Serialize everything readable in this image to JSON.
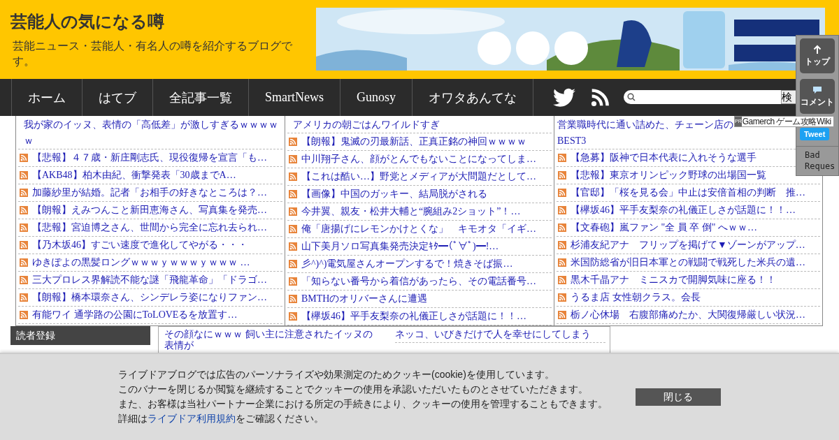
{
  "site": {
    "title": "芸能人の気になる噂",
    "tagline": "芸能ニュース・芸能人・有名人の噂を紹介するブログです。"
  },
  "nav": {
    "items": [
      "ホーム",
      "はてブ",
      "全記事一覧",
      "SmartNews",
      "Gunosy",
      "オワタあんてな"
    ],
    "search_button": "検"
  },
  "side_panel": {
    "buttons": [
      {
        "kind": "top",
        "label": "トップ"
      },
      {
        "kind": "comment",
        "label": "コメント"
      }
    ],
    "tweet": "Tweet",
    "error_text": "Bad Reques"
  },
  "tooltip": {
    "badge": "PR",
    "text": "Gamerch ゲーム攻略Wiki"
  },
  "columns": [
    {
      "heading": [
        "我が家のイッヌ、表情の「高低差」が激しすぎるｗｗｗｗ",
        "ｗ"
      ],
      "items": [
        "【悲報】４７歳・新庄剛志氏、現役復帰を宣言「も…",
        "【AKB48】柏木由紀、衝撃発表「30歳までA…",
        "加藤紗里が結婚。記者「お相手の好きなところは？…",
        "【朗報】えみつんこと新田恵海さん、写真集を発売…",
        "【悲報】宮迫博之さん、世間から完全に忘れ去られ…",
        "【乃木坂46】すごい速度で進化してやがる・・・",
        "ゆきぽよの黒髪ロングｗｗｗｙｗｗｗｙｗｗｗ …",
        "三大プロレス界解読不能な謎「飛龍革命」「ドラゴ…",
        "【朗報】橋本環奈さん、シンデレラ姿になりファン…",
        "有能ワイ 通学路の公園にToLOVEるを放置す…"
      ]
    },
    {
      "heading": [
        "アメリカの朝ごはんワイルドすぎ"
      ],
      "items": [
        "【朗報】鬼滅の刃最新話、正真正銘の神回ｗｗｗｗ",
        "中川翔子さん、顔がとんでもないことになってしま…",
        "【これは酷い…】野党とメディアが大問題だとして…",
        "【画像】中国のガッキー、結局脱がされる",
        "今井翼、親友・松井大輔と“腕組み2ショット”！…",
        "俺「唐揚げにレモンかけとくな」　キモオタ「イギ…",
        "山下美月ソロ写真集発売決定ｷﾀ━(ﾟ∀ﾟ)━!…",
        "彡^)^)電気屋さんオープンするで！焼きそば振…",
        "「知らない番号から着信があったら、その電話番号…",
        "BMTHのオリバーさんに遭遇",
        "【欅坂46】平手友梨奈の礼儀正しさが話題に！！…"
      ]
    },
    {
      "heading": [
        "営業職時代に通い詰めた、チェーン店の",
        "BEST3"
      ],
      "items": [
        "【急募】阪神で日本代表に入れそうな選手",
        "【悲報】東京オリンピック野球の出場国一覧",
        "【官邸】「桜を見る会」中止は安倍首相の判断　推…",
        "【欅坂46】平手友梨奈の礼儀正しさが話題に！！…",
        "【文春砲】嵐ファン \"全 員 卒 倒\" へｗｗ…",
        "杉浦友紀アナ　フリップを掲げて▼ゾーンがアップ…",
        "米国防総省が旧日本軍との戦闘で戦死した米兵の遺…",
        "黒木千晶アナ　ミニスカで開脚気味に座る！！",
        "うるま店 女性朝クラス。会長",
        "栃ノ心休場　右腹部痛めたか、大関復帰厳しい状況…"
      ]
    }
  ],
  "reader_signup": {
    "title": "読者登録"
  },
  "lower_box": {
    "columns": [
      {
        "heading": [
          "その顔なにｗｗｗ 飼い主に注意されたイッヌの",
          "表情が"
        ]
      },
      {
        "heading": [
          "ネッコ、いびきだけで人を幸せにしてしまう"
        ]
      }
    ]
  },
  "cookie_banner": {
    "lines": [
      "ライブドアブログでは広告のパーソナライズや効果測定のためクッキー(cookie)を使用しています。",
      "このバナーを閉じるか閲覧を継続することでクッキーの使用を承認いただいたものとさせていただきます。",
      "また、お客様は当社パートナー企業における所定の手続きにより、クッキーの使用を管理することもできます。"
    ],
    "last_line": {
      "before": "詳細は",
      "link": "ライブドア利用規約",
      "after": "をご確認ください。"
    },
    "close_button": "閉じる"
  }
}
